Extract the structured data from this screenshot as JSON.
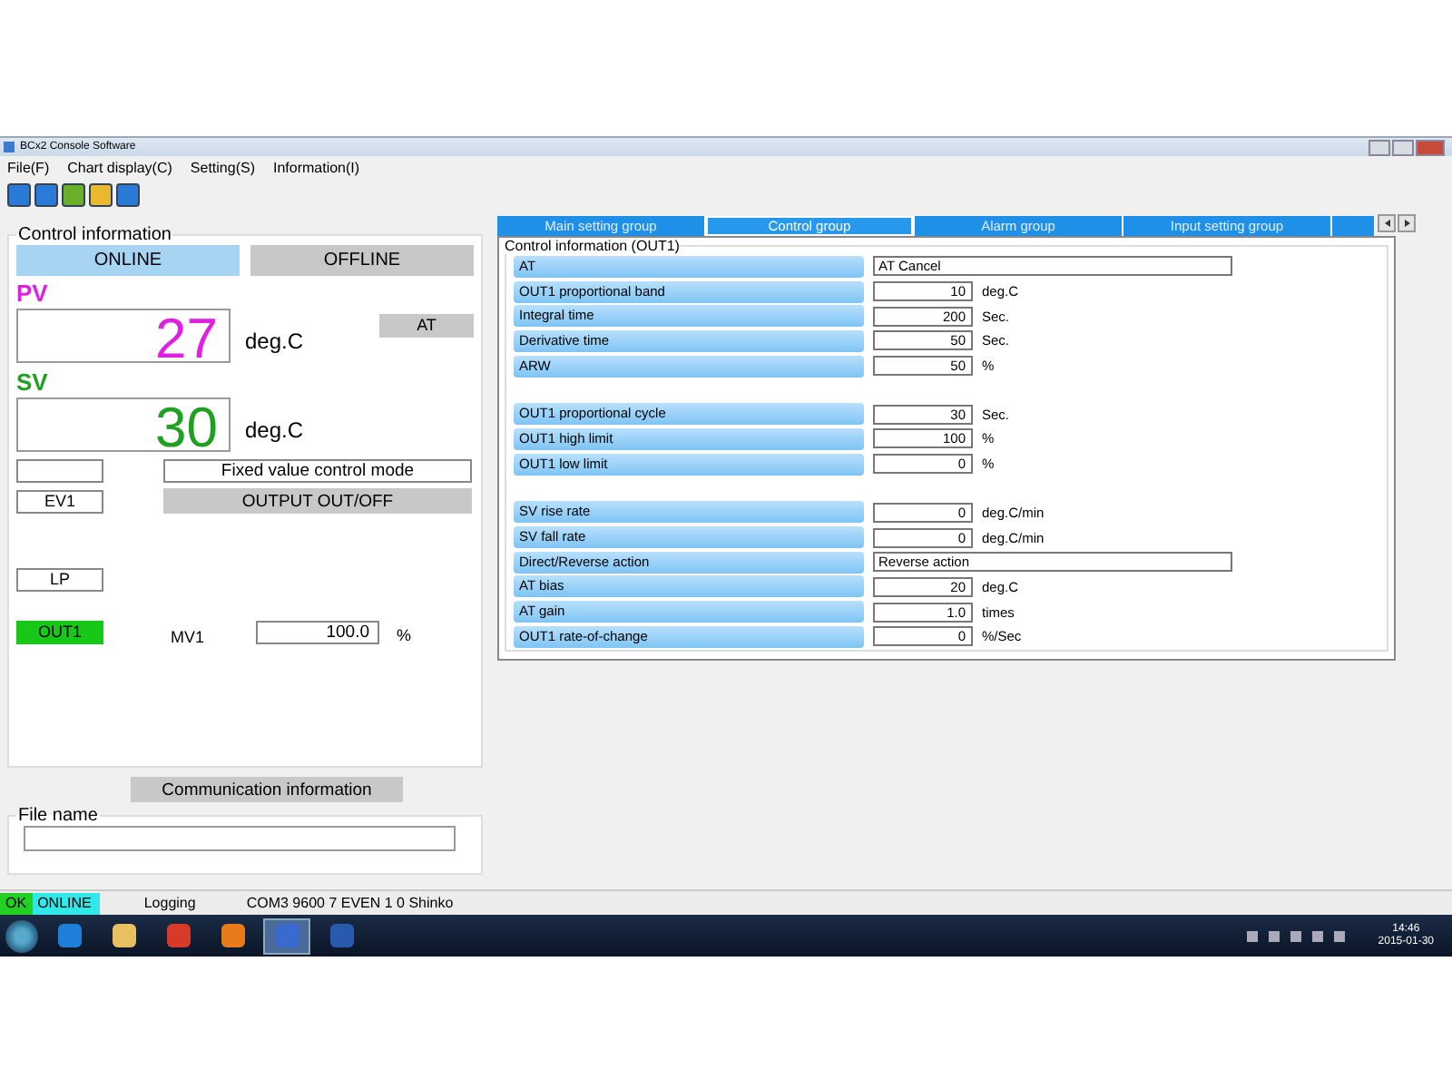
{
  "window": {
    "title": "BCx2 Console Software"
  },
  "menu": [
    {
      "label": "File(F)"
    },
    {
      "label": "Chart display(C)"
    },
    {
      "label": "Setting(S)"
    },
    {
      "label": "Information(I)"
    }
  ],
  "control_info": {
    "title": "Control information",
    "modes": [
      {
        "label": "ONLINE",
        "selected": true
      },
      {
        "label": "OFFLINE",
        "selected": false
      }
    ],
    "pv": {
      "label": "PV",
      "value": "27",
      "unit": "deg.C"
    },
    "at_button": "AT",
    "sv": {
      "label": "SV",
      "value": "30",
      "unit": "deg.C"
    },
    "mode_text": "Fixed value control mode",
    "output_button": "OUTPUT OUT/OFF",
    "indicators": [
      {
        "label": "EV1",
        "on": false
      },
      {
        "label": "LP",
        "on": false
      },
      {
        "label": "OUT1",
        "on": true
      }
    ],
    "mv": {
      "label": "MV1",
      "value": "100.0",
      "unit": "%"
    }
  },
  "communication_button": "Communication information",
  "file_name": {
    "label": "File name"
  },
  "tabs": [
    {
      "label": "Main setting group",
      "selected": false
    },
    {
      "label": "Control group",
      "selected": true
    },
    {
      "label": "Alarm group",
      "selected": false
    },
    {
      "label": "Input setting group",
      "selected": false
    },
    {
      "selected": false
    }
  ],
  "section": {
    "title": "Control information (OUT1)",
    "groups": [
      [
        {
          "kind": "text",
          "label": "AT",
          "value": "AT Cancel"
        },
        {
          "kind": "number",
          "label": "OUT1 proportional band",
          "value": "10",
          "unit": "deg.C"
        },
        {
          "kind": "number",
          "label": "Integral time",
          "value": "200",
          "unit": "Sec."
        },
        {
          "kind": "number",
          "label": "Derivative time",
          "value": "50",
          "unit": "Sec."
        },
        {
          "kind": "number",
          "label": "ARW",
          "value": "50",
          "unit": "%"
        }
      ],
      [
        {
          "kind": "number",
          "label": "OUT1 proportional cycle",
          "value": "30",
          "unit": "Sec."
        },
        {
          "kind": "number",
          "label": "OUT1 high limit",
          "value": "100",
          "unit": "%"
        },
        {
          "kind": "number",
          "label": "OUT1 low limit",
          "value": "0",
          "unit": "%"
        }
      ],
      [
        {
          "kind": "number",
          "label": "SV rise rate",
          "value": "0",
          "unit": "deg.C/min"
        },
        {
          "kind": "number",
          "label": "SV fall rate",
          "value": "0",
          "unit": "deg.C/min"
        },
        {
          "kind": "text",
          "label": "Direct/Reverse action",
          "value": "Reverse action"
        },
        {
          "kind": "number",
          "label": "AT bias",
          "value": "20",
          "unit": "deg.C"
        },
        {
          "kind": "number",
          "label": "AT gain",
          "value": "1.0",
          "unit": "times"
        },
        {
          "kind": "number",
          "label": "OUT1 rate-of-change",
          "value": "0",
          "unit": "%/Sec"
        }
      ]
    ]
  },
  "status_bar": {
    "ok": "OK",
    "connection": "ONLINE",
    "logging": "Logging",
    "port": "COM3 9600 7 EVEN 1 0 Shinko"
  },
  "taskbar": {
    "apps": [
      {
        "kind": "browser",
        "selected": false
      },
      {
        "kind": "folder",
        "selected": false
      },
      {
        "kind": "chrome",
        "selected": false
      },
      {
        "kind": "mail",
        "selected": false
      },
      {
        "kind": "console",
        "selected": true
      },
      {
        "kind": "word",
        "selected": false
      }
    ],
    "time": "14:46",
    "date": "2015-01-30"
  }
}
